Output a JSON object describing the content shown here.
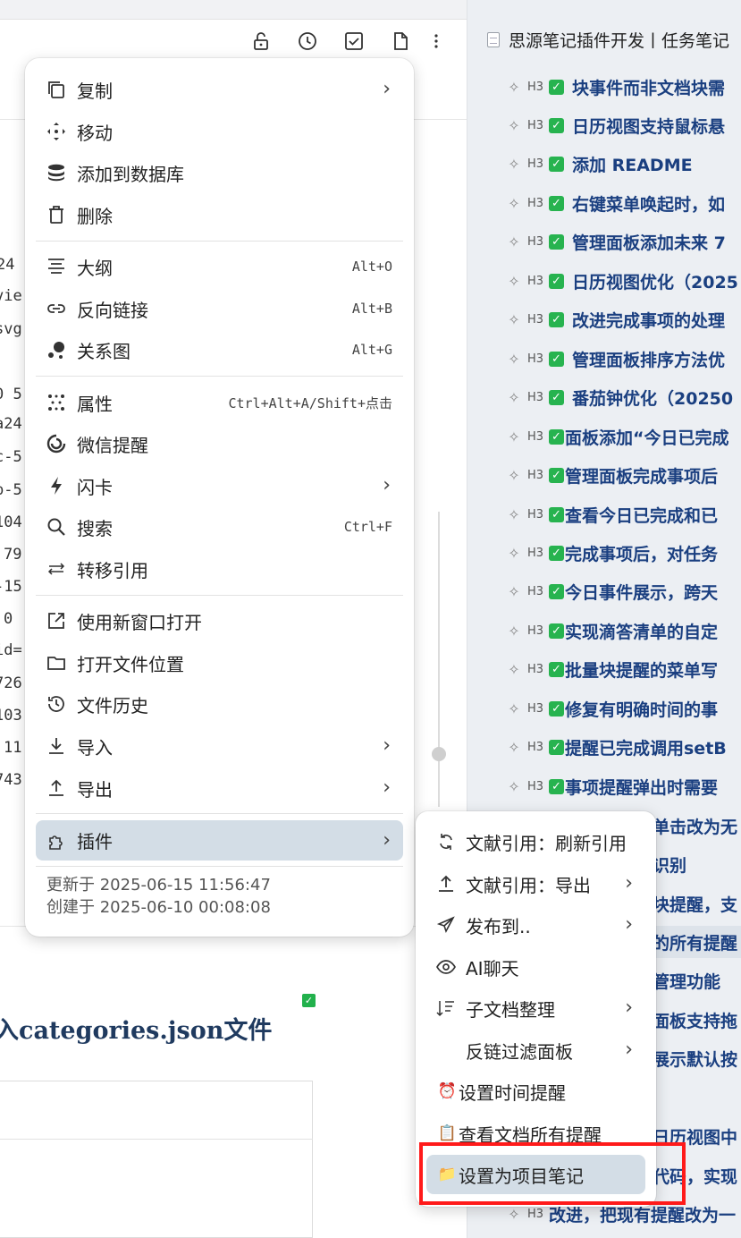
{
  "outline": {
    "doc_title": "思源笔记插件开发丨任务笔记",
    "heading_marker": "H3",
    "items": [
      {
        "text": "块事件而非文档块需"
      },
      {
        "text": "日历视图支持鼠标悬"
      },
      {
        "text": "添加 README"
      },
      {
        "text": "右键菜单唤起时，如"
      },
      {
        "text": "管理面板添加未来 7"
      },
      {
        "text": "日历视图优化（2025"
      },
      {
        "text": "改进完成事项的处理"
      },
      {
        "text": "管理面板排序方法优"
      },
      {
        "text": "番茄钟优化（20250"
      },
      {
        "text": "面板添加“今日已完成"
      },
      {
        "text": "管理面板完成事项后"
      },
      {
        "text": "查看今日已完成和已"
      },
      {
        "text": "完成事项后，对任务"
      },
      {
        "text": "今日事件展示，跨天"
      },
      {
        "text": "实现滴答清单的自定"
      },
      {
        "text": "批量块提醒的菜单写"
      },
      {
        "text": "修复有明确时间的事"
      },
      {
        "text": "提醒已完成调用setB"
      },
      {
        "text": "事项提醒弹出时需要"
      }
    ],
    "partial_items": [
      {
        "text": "单击改为无"
      },
      {
        "text": "识别"
      },
      {
        "text": "块提醒，支"
      },
      {
        "text": "的所有提醒"
      },
      {
        "text": "管理功能"
      },
      {
        "text": "面板支持拖"
      },
      {
        "text": "展示默认按"
      },
      {
        "text": "日历视图中"
      },
      {
        "text": "代码，实现"
      },
      {
        "text": "改进，把现有提醒改为一"
      }
    ]
  },
  "editor": {
    "code_fragments": [
      "24",
      "vie",
      "svg",
      "0 5",
      "a24",
      "c-5",
      "b-5",
      "104",
      "79",
      "-15",
      "0",
      "id=",
      "726",
      "103",
      "11",
      "743"
    ],
    "heading_fragment": "入categories.json文件"
  },
  "menu": {
    "items": [
      {
        "label": "复制",
        "icon": "copy-icon",
        "submenu": true
      },
      {
        "label": "移动",
        "icon": "move-icon"
      },
      {
        "label": "添加到数据库",
        "icon": "database-icon"
      },
      {
        "label": "删除",
        "icon": "trash-icon"
      },
      {
        "label": "大纲",
        "icon": "outline-icon",
        "shortcut": "Alt+O"
      },
      {
        "label": "反向链接",
        "icon": "link-icon",
        "shortcut": "Alt+B"
      },
      {
        "label": "关系图",
        "icon": "graph-icon",
        "shortcut": "Alt+G"
      },
      {
        "label": "属性",
        "icon": "attributes-icon",
        "shortcut": "Ctrl+Alt+A/Shift+点击"
      },
      {
        "label": "微信提醒",
        "icon": "wechat-reminder-icon"
      },
      {
        "label": "闪卡",
        "icon": "flashcard-icon",
        "submenu": true
      },
      {
        "label": "搜索",
        "icon": "search-icon",
        "shortcut": "Ctrl+F"
      },
      {
        "label": "转移引用",
        "icon": "transfer-ref-icon"
      },
      {
        "label": "使用新窗口打开",
        "icon": "open-window-icon"
      },
      {
        "label": "打开文件位置",
        "icon": "folder-icon"
      },
      {
        "label": "文件历史",
        "icon": "history-icon"
      },
      {
        "label": "导入",
        "icon": "import-icon",
        "submenu": true
      },
      {
        "label": "导出",
        "icon": "export-icon",
        "submenu": true
      },
      {
        "label": "插件",
        "icon": "plugin-icon",
        "submenu": true,
        "active": true
      }
    ],
    "updated": "更新于 2025-06-15 11:56:47",
    "created": "创建于 2025-06-10 00:08:08"
  },
  "submenu": {
    "items": [
      {
        "label": "文献引用：刷新引用",
        "icon": "refresh-icon"
      },
      {
        "label": "文献引用：导出",
        "icon": "upload-icon",
        "submenu": true
      },
      {
        "label": "发布到..",
        "icon": "send-icon",
        "submenu": true
      },
      {
        "label": "AI聊天",
        "icon": "eye-icon"
      },
      {
        "label": "子文档整理",
        "icon": "sort-icon",
        "submenu": true
      },
      {
        "label": "反链过滤面板",
        "icon": "",
        "submenu": true
      },
      {
        "label": "设置时间提醒",
        "icon": "alarm-clock-icon",
        "emoji": "⏰"
      },
      {
        "label": "查看文档所有提醒",
        "icon": "clipboard-icon",
        "emoji": "📋"
      },
      {
        "label": "设置为项目笔记",
        "icon": "folder-emoji-icon",
        "emoji": "📁",
        "active": true
      }
    ]
  },
  "colors": {
    "highlight": "#d3dde6",
    "checkbox": "#27b34f",
    "heading_text": "#1a3f80",
    "annotation_box": "#ff1a1a"
  }
}
